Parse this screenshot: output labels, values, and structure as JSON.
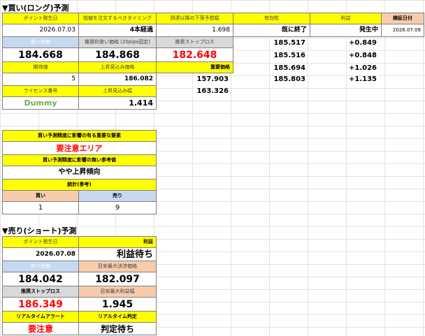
{
  "long": {
    "title": "▼買い(ロング)予測",
    "h_point_date": "ポイント発生日",
    "h_timing": "指値を注文するべきタイミング",
    "h_fall_forecast": "到達以降の下落予想幅",
    "h_validity": "有効性",
    "h_profit": "利益",
    "h_verify_date": "検証日付",
    "point_date": "2026.07.03",
    "timing": "4本経過",
    "fall_forecast": "1.698",
    "validity": "既に終了",
    "profit_status": "発生中",
    "verify_date": "2026.07.09",
    "h_buy_limit": "買い指値",
    "h_recommended_buy": "推奨利食い価格 (20pips固定)",
    "h_recommended_stop": "推奨ストップロス",
    "buy_limit": "184.668",
    "recommended_buy": "184.868",
    "recommended_stop": "182.648",
    "h_candles": "期待値",
    "h_upper_forecast": "上昇見込み価格",
    "h_important_price": "重要価格",
    "candles": "5",
    "upper_forecast": "186.082",
    "important_price": "157.903",
    "h_license": "ライセンス番号",
    "h_upper_width": "上昇見込み幅",
    "license": "Dummy",
    "upper_width": "1.414",
    "extra_value": "163.326",
    "prices": [
      "185.517",
      "185.516",
      "185.694",
      "185.803"
    ],
    "pips": [
      "+0.849",
      "+0.848",
      "+1.026",
      "+1.135"
    ]
  },
  "impact": {
    "h_trend_impact": "買い予測精度に影響の有る重要な要素",
    "trend_impact": "要注意エリア",
    "h_trend_tilt": "買い予測精度に影響の無い参考値",
    "trend_tilt": "やや上昇傾向",
    "h_stats": "統計(参考)",
    "h_buy": "買い",
    "h_sell": "売り",
    "buy_count": "1",
    "sell_count": "9"
  },
  "short": {
    "title": "▼売り(ショート)予測",
    "h_point_date": "ポイント発生日",
    "h_profit": "利益",
    "point_date": "2026.07.08",
    "profit_status": "利益待ち",
    "h_sell_limit": "売り指値",
    "h_target_big": "目安最大決済価格",
    "sell_limit": "184.042",
    "target_big": "182.097",
    "h_recommended_stop": "推奨ストップロス",
    "h_target_width": "目安最大利益幅",
    "recommended_stop": "186.349",
    "target_width": "1.945",
    "h_realtime_alert": "リアルタイムアラート",
    "h_realtime_judge": "リアルタイム判定",
    "realtime_alert": "要注意",
    "realtime_judge": "判定待ち"
  }
}
